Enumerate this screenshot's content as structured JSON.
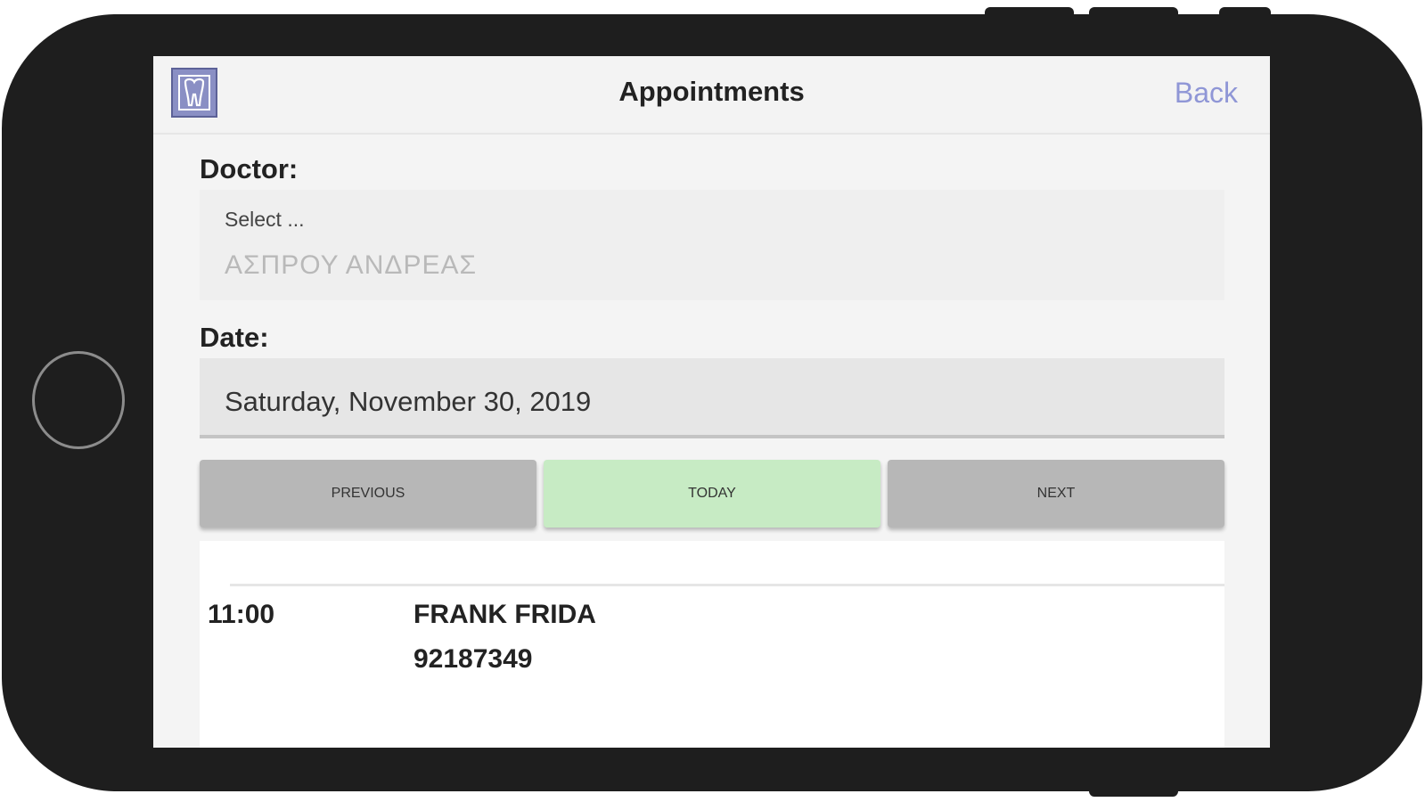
{
  "navbar": {
    "title": "Appointments",
    "back_label": "Back",
    "logo_icon": "tooth-logo-icon"
  },
  "doctor": {
    "label": "Doctor:",
    "hint": "Select ...",
    "selected": "ΑΣΠΡΟΥ ΑΝΔΡΕΑΣ"
  },
  "date": {
    "label": "Date:",
    "value": "Saturday, November 30, 2019"
  },
  "buttons": {
    "previous": "PREVIOUS",
    "today": "TODAY",
    "next": "NEXT"
  },
  "appointments": [
    {
      "time": "11:00",
      "name": "FRANK FRIDA",
      "phone": "92187349"
    }
  ],
  "colors": {
    "accent_link": "#8f96d6",
    "today_button": "#c7ebc4",
    "nav_button": "#b7b7b7",
    "logo": "#8a8fc4",
    "phone_frame": "#1e1e1e"
  }
}
